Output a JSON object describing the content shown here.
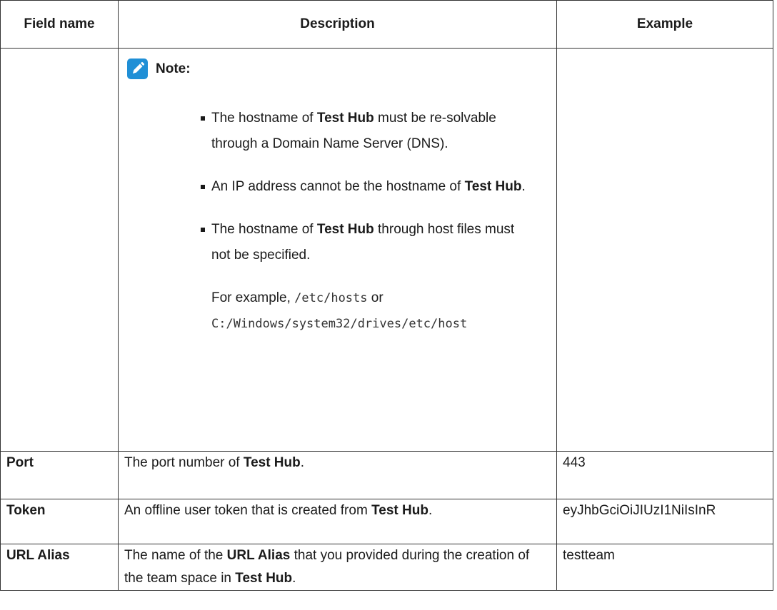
{
  "table": {
    "headers": [
      "Field name",
      "Description",
      "Example"
    ],
    "note": {
      "label": "Note:",
      "items": [
        {
          "parts": [
            "The hostname of ",
            "Test Hub",
            " must be re-solvable through a Domain Name Server (DNS)."
          ]
        },
        {
          "parts": [
            "An IP address cannot be the hostname of ",
            "Test Hub",
            "."
          ]
        },
        {
          "parts": [
            "The hostname of ",
            "Test Hub",
            " through host files must not be specified."
          ],
          "example": {
            "prefix": "For example, ",
            "path1": "/etc/hosts",
            "or": " or ",
            "path2": "C:/Windows/system32/drives/etc/host"
          }
        }
      ]
    },
    "rows": [
      {
        "field": "Port",
        "desc_parts": [
          "The port number of ",
          "Test Hub",
          "."
        ],
        "example": "443"
      },
      {
        "field": "Token",
        "desc_parts": [
          "An offline user token that is created from ",
          "Test Hub",
          "."
        ],
        "example": "eyJhbGciOiJIUzI1NiIsInR"
      },
      {
        "field": "URL Alias",
        "desc_parts": [
          "The name of the ",
          "URL Alias",
          " that you provided during the creation of the team space in ",
          "Test Hub",
          "."
        ],
        "example": "testteam"
      }
    ]
  }
}
